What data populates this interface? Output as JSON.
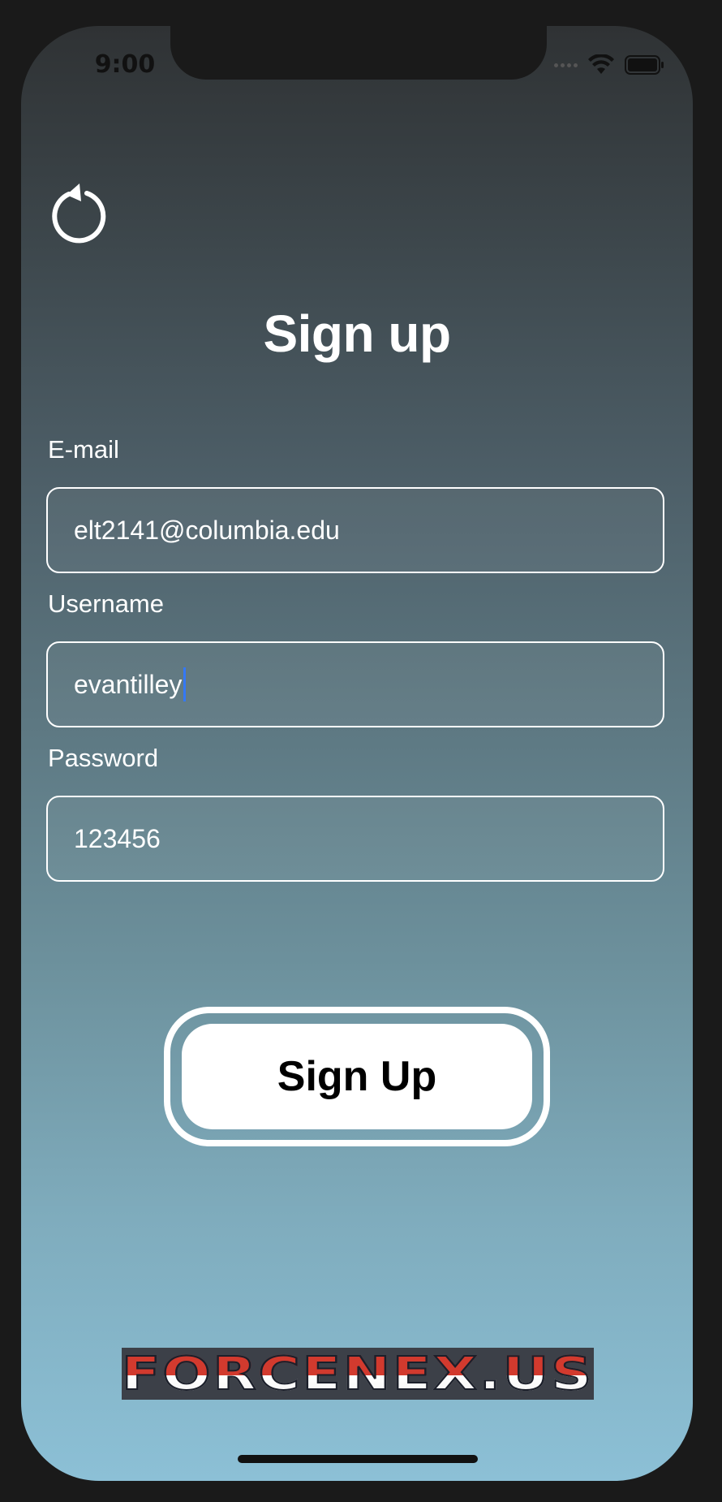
{
  "status_bar": {
    "time": "9:00",
    "icons": [
      "signal-icon",
      "wifi-icon",
      "battery-icon"
    ]
  },
  "refresh_icon": "refresh-icon",
  "title": "Sign up",
  "form": {
    "email": {
      "label": "E-mail",
      "value": "elt2141@columbia.edu"
    },
    "username": {
      "label": "Username",
      "value": "evantilley"
    },
    "password": {
      "label": "Password",
      "value": "123456"
    }
  },
  "signup_button": {
    "label": "Sign Up"
  },
  "logo": {
    "text": "FORCENEX.US"
  },
  "colors": {
    "gradient_top": "#2f3234",
    "gradient_bottom": "#8cc0d6",
    "text": "#ffffff",
    "caret": "#3478f6",
    "logo_red": "#d23a2e"
  }
}
